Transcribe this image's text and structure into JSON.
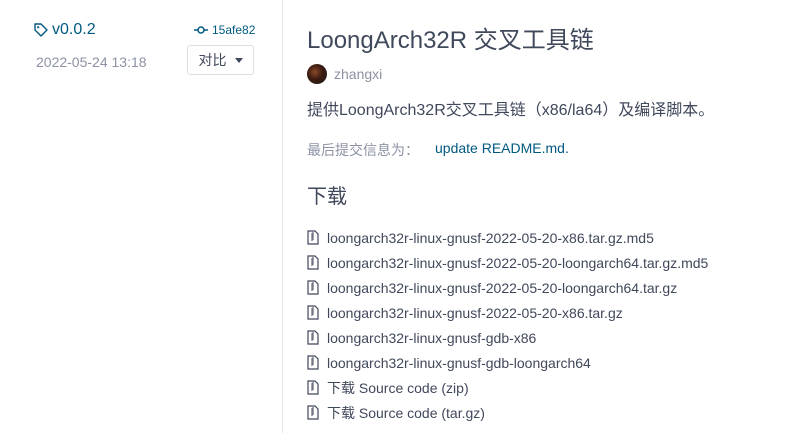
{
  "release": {
    "tag": "v0.0.2",
    "date": "2022-05-24 13:18",
    "commit": "15afe82",
    "compare_label": "对比",
    "title": "LoongArch32R 交叉工具链",
    "author": "zhangxi",
    "description": "提供LoongArch32R交叉工具链（x86/la64）及编译脚本。",
    "last_commit_label": "最后提交信息为：",
    "last_commit_message": "update README.md.",
    "downloads_heading": "下载"
  },
  "files": [
    "loongarch32r-linux-gnusf-2022-05-20-x86.tar.gz.md5",
    "loongarch32r-linux-gnusf-2022-05-20-loongarch64.tar.gz.md5",
    "loongarch32r-linux-gnusf-2022-05-20-loongarch64.tar.gz",
    "loongarch32r-linux-gnusf-2022-05-20-x86.tar.gz",
    "loongarch32r-linux-gnusf-gdb-x86",
    "loongarch32r-linux-gnusf-gdb-loongarch64",
    "下载 Source code (zip)",
    "下载 Source code (tar.gz)"
  ],
  "colors": {
    "link": "#005980",
    "text": "#40485b",
    "muted": "#8c92a4"
  },
  "icons": {
    "tag": "tag-icon",
    "commit": "commit-icon",
    "file": "zip-file-icon"
  }
}
